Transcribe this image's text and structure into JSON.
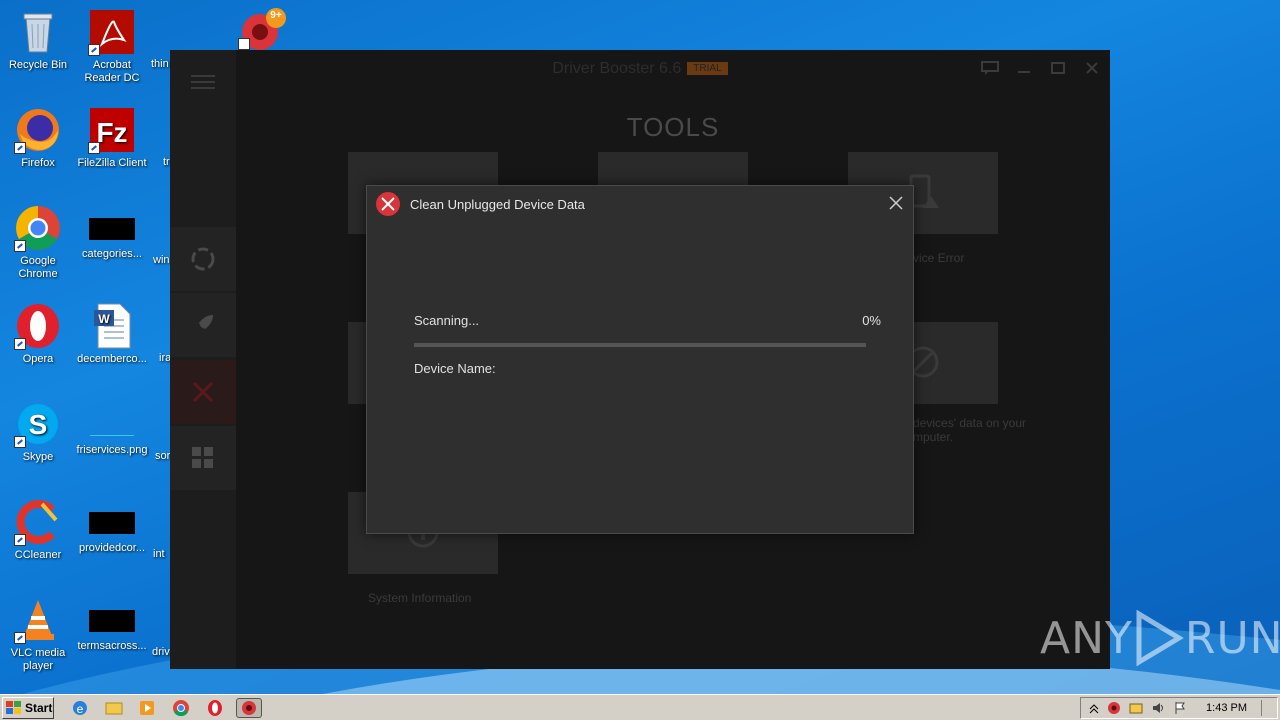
{
  "desktop": {
    "icons": [
      {
        "id": "recycle-bin",
        "label": "Recycle Bin"
      },
      {
        "id": "acrobat",
        "label": "Acrobat Reader DC"
      },
      {
        "id": "thin",
        "label": "thin"
      },
      {
        "id": "firefox",
        "label": "Firefox"
      },
      {
        "id": "filezilla",
        "label": "FileZilla Client"
      },
      {
        "id": "tr",
        "label": "tr"
      },
      {
        "id": "chrome",
        "label": "Google Chrome"
      },
      {
        "id": "categories",
        "label": "categories..."
      },
      {
        "id": "win",
        "label": "win"
      },
      {
        "id": "opera",
        "label": "Opera"
      },
      {
        "id": "decemberco",
        "label": "decemberco..."
      },
      {
        "id": "ira",
        "label": "ira"
      },
      {
        "id": "skype",
        "label": "Skype"
      },
      {
        "id": "friservices",
        "label": "friservices.png"
      },
      {
        "id": "sor",
        "label": "sor"
      },
      {
        "id": "ccleaner",
        "label": "CCleaner"
      },
      {
        "id": "providedcor",
        "label": "providedcor..."
      },
      {
        "id": "int",
        "label": "int"
      },
      {
        "id": "vlc",
        "label": "VLC media player"
      },
      {
        "id": "termsacross",
        "label": "termsacross..."
      },
      {
        "id": "driv",
        "label": "driv"
      }
    ],
    "driver_booster_badge": "9+"
  },
  "app_window": {
    "title": "Driver Booster 6.6",
    "trial_badge": "TRIAL",
    "heading": "TOOLS",
    "labels": {
      "device_error": "vice Error",
      "devices_data_line1": "devices' data on your",
      "devices_data_line2": "mputer.",
      "system_information": "System Information"
    }
  },
  "dialog": {
    "title": "Clean Unplugged Device Data",
    "scanning_label": "Scanning...",
    "percent": "0%",
    "progress": 0,
    "device_name_label": "Device Name:"
  },
  "taskbar": {
    "start_label": "Start",
    "clock": "1:43 PM"
  },
  "watermark": {
    "left": "ANY",
    "right": "RUN"
  },
  "colors": {
    "accent_red": "#d8343a",
    "trial_orange": "#e07a1f",
    "desktop_blue": "#0b72cf"
  }
}
